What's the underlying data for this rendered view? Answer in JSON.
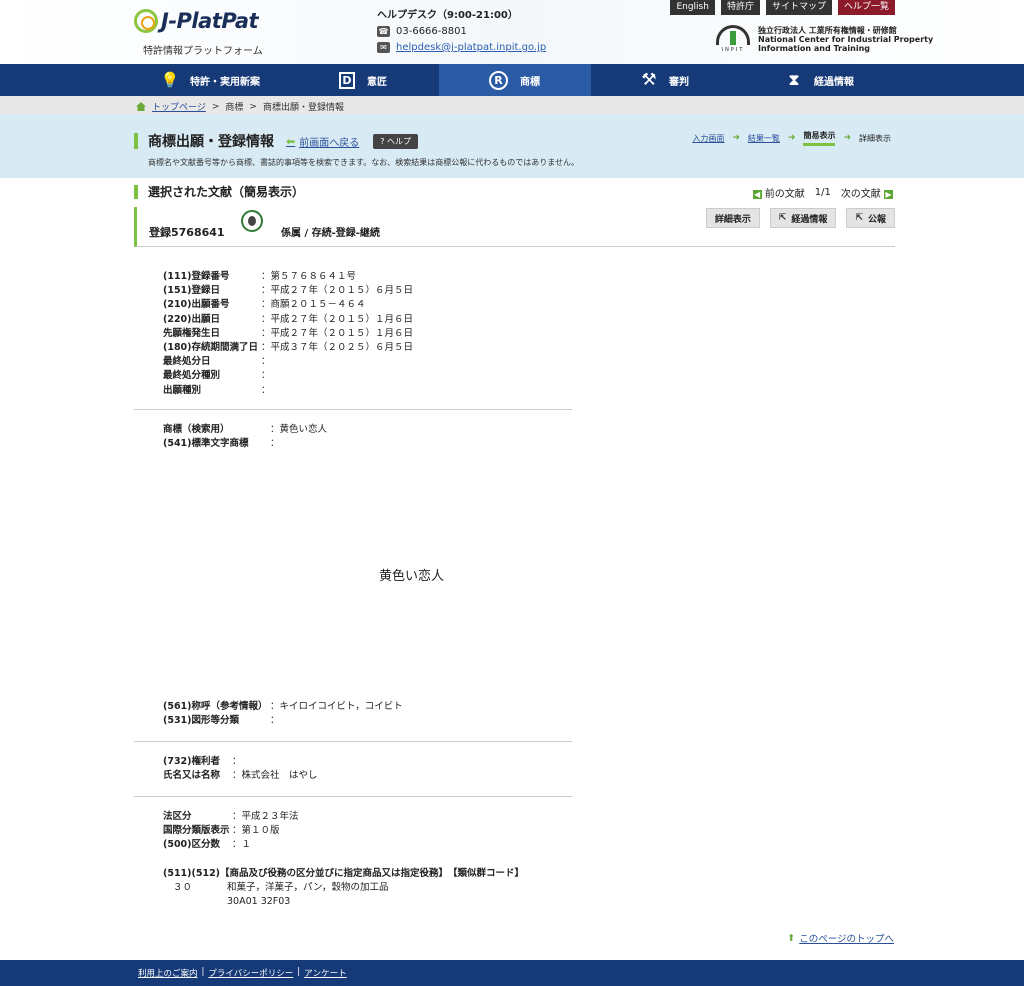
{
  "header": {
    "logo_text": "J-PlatPat",
    "logo_sub": "特許情報プラットフォーム",
    "helpdesk_title": "ヘルプデスク（9:00-21:00）",
    "phone": "03-6666-8801",
    "email": "helpdesk@j-platpat.inpit.go.jp",
    "top_links": [
      "English",
      "特許庁",
      "サイトマップ",
      "ヘルプ一覧"
    ],
    "inpit_label": "INPIT",
    "inpit_line1": "独立行政法人 工業所有権情報・研修館",
    "inpit_line2": "National Center for Industrial Property",
    "inpit_line3": "Information and Training"
  },
  "nav": {
    "items": [
      {
        "label": "特許・実用新案",
        "icon": "lightbulb-icon"
      },
      {
        "label": "意匠",
        "icon": "design-d-icon"
      },
      {
        "label": "商標",
        "icon": "registered-trademark-icon"
      },
      {
        "label": "審判",
        "icon": "gavel-icon"
      },
      {
        "label": "経過情報",
        "icon": "hourglass-icon"
      }
    ]
  },
  "breadcrumb": {
    "home": "トップページ",
    "sep": ">",
    "level1": "商標",
    "level2": "商標出願・登録情報"
  },
  "band": {
    "title": "商標出願・登録情報",
    "back": "前画面へ戻る",
    "help": "ヘルプ",
    "desc": "商標名や文献番号等から商標、書誌的事項等を検索できます。なお、検索結果は商標公報に代わるものではありません。",
    "steps": [
      "入力画面",
      "結果一覧",
      "簡易表示",
      "詳細表示"
    ]
  },
  "section": {
    "title": "選択された文献（簡易表示）",
    "prev": "前の文献",
    "count": "1/1",
    "next": "次の文献"
  },
  "record": {
    "reg_no": "登録5768641",
    "status": "係属 / 存続-登録-継続",
    "buttons": [
      "詳細表示",
      "経過情報",
      "公報"
    ]
  },
  "bib1": [
    {
      "k": "(111)登録番号",
      "v": "：第５７６８６４１号"
    },
    {
      "k": "(151)登録日",
      "v": "：平成２７年（２０１５）６月５日"
    },
    {
      "k": "(210)出願番号",
      "v": "：商願２０１５－４６４"
    },
    {
      "k": "(220)出願日",
      "v": "：平成２７年（２０１５）１月６日"
    },
    {
      "k": "先願権発生日",
      "v": "：平成２７年（２０１５）１月６日"
    },
    {
      "k": "(180)存続期間満了日",
      "v": "：平成３７年（２０２５）６月５日"
    },
    {
      "k": "最終処分日",
      "v": "："
    },
    {
      "k": "最終処分種別",
      "v": "："
    },
    {
      "k": "出願種別",
      "v": "："
    }
  ],
  "bib2": [
    {
      "k": "商標（検索用）",
      "v": "：黄色い恋人"
    },
    {
      "k": "(541)標準文字商標",
      "v": "："
    }
  ],
  "trademark_image_text": "黄色い恋人",
  "bib3": [
    {
      "k": "(561)称呼（参考情報）",
      "v": "：キイロイコイビト，コイビト"
    },
    {
      "k": "(531)図形等分類",
      "v": "："
    }
  ],
  "bib4": [
    {
      "k": "(732)権利者",
      "v": "："
    },
    {
      "k": "氏名又は名称",
      "v": "：株式会社　はやし"
    }
  ],
  "bib5": [
    {
      "k": "法区分",
      "v": "：平成２３年法"
    },
    {
      "k": "国際分類版表示",
      "v": "：第１０版"
    },
    {
      "k": "(500)区分数",
      "v": "：１"
    }
  ],
  "goods": {
    "head": "(511)(512)【商品及び役務の区分並びに指定商品又は指定役務】　【類似群コード】",
    "class": "３０",
    "items": "和菓子，洋菓子，パン，穀物の加工品",
    "codes": "30A01 32F03"
  },
  "to_top": "このページのトップへ",
  "footer": {
    "links": [
      "利用上のご案内",
      "プライバシーポリシー",
      "アンケート"
    ],
    "sep": "|"
  }
}
